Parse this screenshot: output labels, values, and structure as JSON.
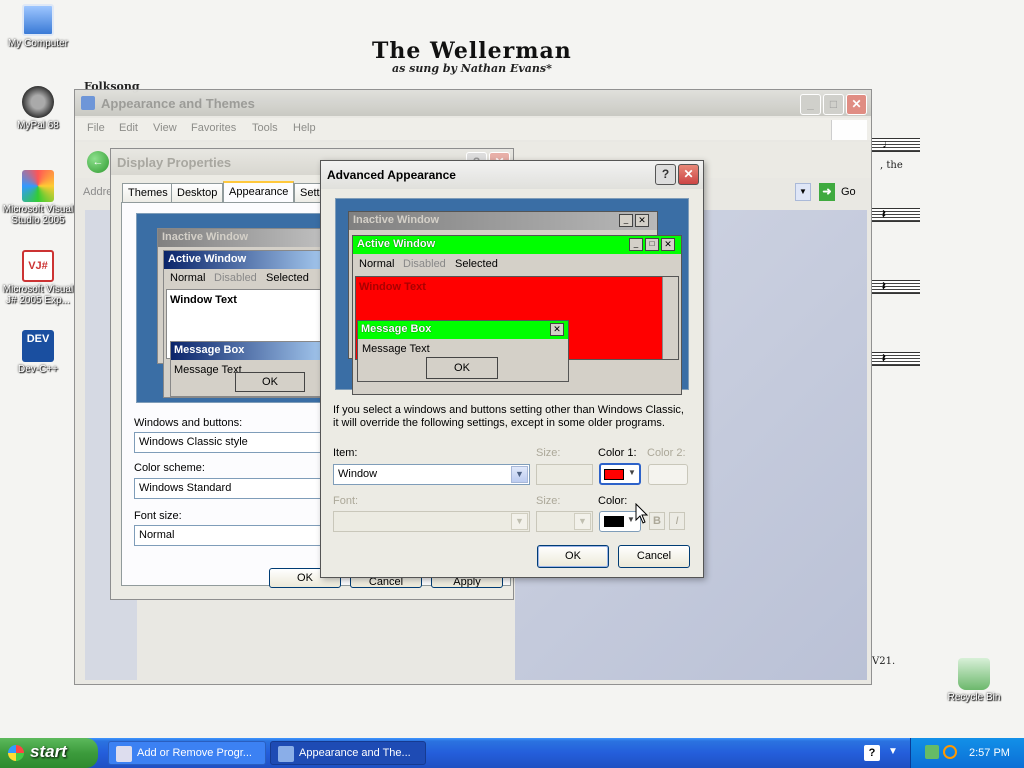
{
  "desktop": {
    "sheet_title": "The Wellerman",
    "sheet_subtitle": "as sung by Nathan Evans*",
    "sheet_folksong": "Folksong",
    "lyric_fragment": ", the",
    "footer_fragment": "V21.",
    "icons": [
      {
        "label": "My Computer",
        "icon": "computer-icon"
      },
      {
        "label": "MyPal 68",
        "icon": "raccoon-app-icon"
      },
      {
        "label": "Microsoft Visual Studio 2005",
        "icon": "visual-studio-icon"
      },
      {
        "label": "Microsoft Visual J# 2005 Exp...",
        "icon": "visual-jsharp-icon"
      },
      {
        "label": "Dev-C++",
        "icon": "devcpp-icon"
      },
      {
        "label": "Recycle Bin",
        "icon": "recycle-bin-icon"
      }
    ]
  },
  "explorer": {
    "title": "Appearance and Themes",
    "menu": [
      "File",
      "Edit",
      "View",
      "Favorites",
      "Tools",
      "Help"
    ],
    "address_label": "Addre",
    "go_label": "Go"
  },
  "display_props": {
    "title": "Display Properties",
    "tabs": [
      "Themes",
      "Desktop",
      "Appearance",
      "Setti"
    ],
    "active_tab": "Appearance",
    "preview": {
      "inactive": "Inactive Window",
      "active": "Active Window",
      "menu_normal": "Normal",
      "menu_disabled": "Disabled",
      "menu_selected": "Selected",
      "window_text": "Window Text",
      "msgbox_title": "Message Box",
      "msgbox_text": "Message Text",
      "ok": "OK"
    },
    "windows_buttons_label": "Windows and buttons:",
    "windows_buttons_value": "Windows Classic style",
    "color_scheme_label": "Color scheme:",
    "color_scheme_value": "Windows Standard",
    "font_size_label": "Font size:",
    "font_size_value": "Normal",
    "ok": "OK",
    "cancel": "Cancel",
    "apply": "Apply"
  },
  "advanced": {
    "title": "Advanced Appearance",
    "preview": {
      "inactive": "Inactive Window",
      "active": "Active Window",
      "menu_normal": "Normal",
      "menu_disabled": "Disabled",
      "menu_selected": "Selected",
      "window_text": "Window Text",
      "msgbox_title": "Message Box",
      "msgbox_text": "Message Text",
      "ok": "OK"
    },
    "note_line1": "If you select a windows and buttons setting other than Windows Classic,",
    "note_line2": "it will override the following settings, except in some older programs.",
    "item_label": "Item:",
    "item_value": "Window",
    "size_label": "Size:",
    "color1_label": "Color 1:",
    "color2_label": "Color 2:",
    "font_label": "Font:",
    "font_size_label": "Size:",
    "font_color_label": "Color:",
    "bold_label": "B",
    "italic_label": "I",
    "ok": "OK",
    "cancel": "Cancel",
    "colors": {
      "active_title": "#00ff00",
      "window_bg": "#ff0000",
      "color1": "#ff0000",
      "font_color": "#000000"
    }
  },
  "taskbar": {
    "start": "start",
    "tasks": [
      "Add or Remove Progr...",
      "Appearance and The..."
    ],
    "clock": "2:57 PM"
  }
}
